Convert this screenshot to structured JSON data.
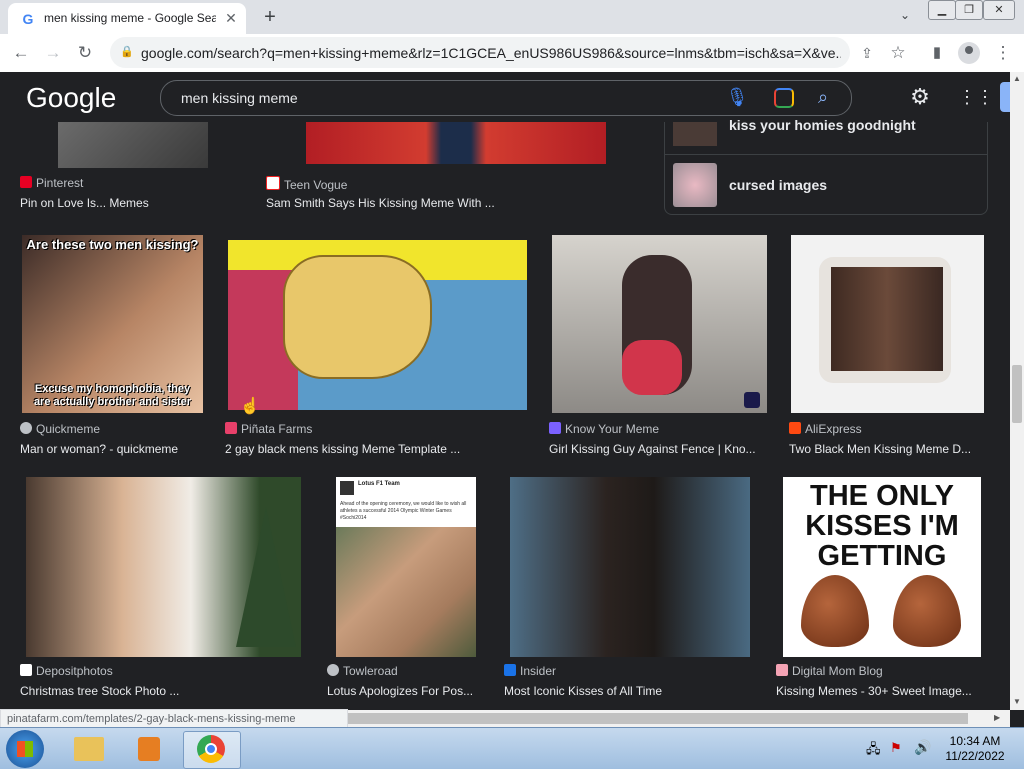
{
  "browser": {
    "tab_title": "men kissing meme - Google Sea",
    "url": "google.com/search?q=men+kissing+meme&rlz=1C1GCEA_enUS986US986&source=lnms&tbm=isch&sa=X&ve..."
  },
  "google": {
    "logo": "Google",
    "query": "men kissing meme"
  },
  "related": [
    {
      "label": "kiss your homies goodnight"
    },
    {
      "label": "cursed images"
    }
  ],
  "row1": [
    {
      "source": "Pinterest",
      "title": "Pin on Love Is... Memes"
    },
    {
      "source": "Teen Vogue",
      "title": "Sam Smith Says His Kissing Meme With ..."
    }
  ],
  "row2": [
    {
      "source": "Quickmeme",
      "title": "Man or woman? - quickmeme",
      "caption_top": "Are these two men kissing?",
      "caption_bottom": "Excuse my homophobia, they are actually brother and sister"
    },
    {
      "source": "Piñata Farms",
      "title": "2 gay black mens kissing Meme Template ..."
    },
    {
      "source": "Know Your Meme",
      "title": "Girl Kissing Guy Against Fence | Kno..."
    },
    {
      "source": "AliExpress",
      "title": "Two Black Men Kissing Meme D..."
    }
  ],
  "row3": [
    {
      "source": "Depositphotos",
      "title": "Christmas tree Stock Photo ..."
    },
    {
      "source": "Towleroad",
      "title": "Lotus Apologizes For Pos...",
      "tweet_name": "Lotus F1 Team",
      "tweet_text": "Ahead of the opening ceremony, we would like to wish all athletes a successful 2014 Olympic Winter Games #Sochi2014"
    },
    {
      "source": "Insider",
      "title": "Most Iconic Kisses of All Time"
    },
    {
      "source": "Digital Mom Blog",
      "title": "Kissing Memes - 30+ Sweet Image...",
      "meme_text": "THE ONLY KISSES I'M GETTING"
    }
  ],
  "status_url": "pinatafarm.com/templates/2-gay-black-mens-kissing-meme",
  "taskbar": {
    "time": "10:34 AM",
    "date": "11/22/2022"
  }
}
